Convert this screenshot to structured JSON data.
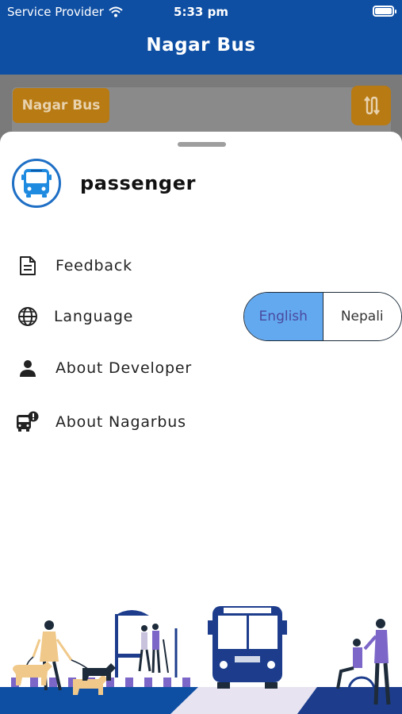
{
  "status_bar": {
    "carrier": "Service Provider",
    "time": "5:33 pm"
  },
  "header": {
    "title": "Nagar Bus"
  },
  "background_screen": {
    "chip_label": "Nagar Bus"
  },
  "profile": {
    "username": "passenger"
  },
  "menu": {
    "feedback": "Feedback",
    "language": "Language",
    "about_developer": "About Developer",
    "about_nagarbus": "About Nagarbus"
  },
  "language_toggle": {
    "options": [
      "English",
      "Nepali"
    ],
    "selected": "English"
  },
  "colors": {
    "header_bg": "#0f4fa3",
    "accent": "#1f6fc5",
    "toggle_active": "#63a9ef",
    "chip": "#b87a13"
  }
}
